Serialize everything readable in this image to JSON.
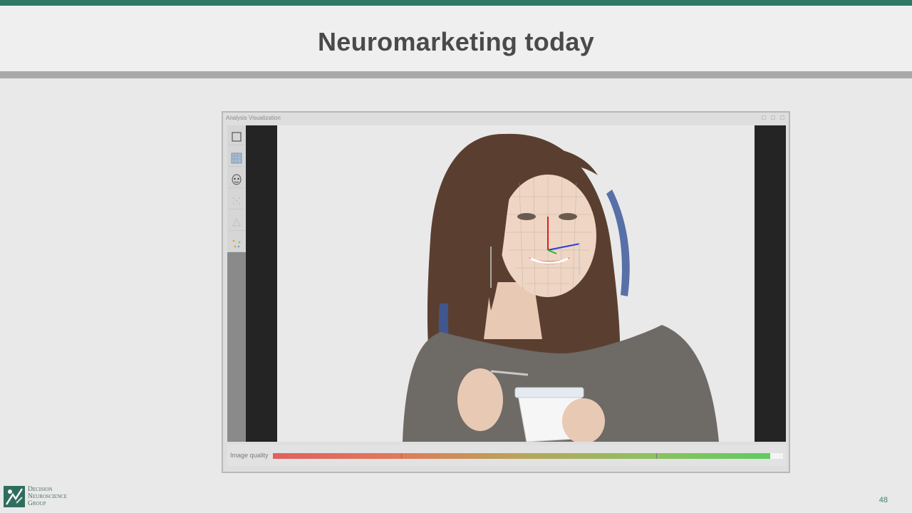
{
  "slide": {
    "title": "Neuromarketing today",
    "page_number": "48",
    "accent_color": "#2f7a66"
  },
  "window": {
    "title": "Analysis Visualization",
    "controls": [
      "minimize-icon",
      "maximize-icon",
      "close-icon"
    ],
    "toolbar_icons": [
      "square-select-icon",
      "grid-select-icon",
      "face-icon",
      "landmark-points-icon",
      "mesh-icon",
      "axis-points-icon"
    ],
    "status": {
      "quality_label": "Image quality",
      "quality_fraction": 0.975
    }
  },
  "logo": {
    "line1": "Decision",
    "line2": "Neuroscience",
    "line3": "Group"
  }
}
